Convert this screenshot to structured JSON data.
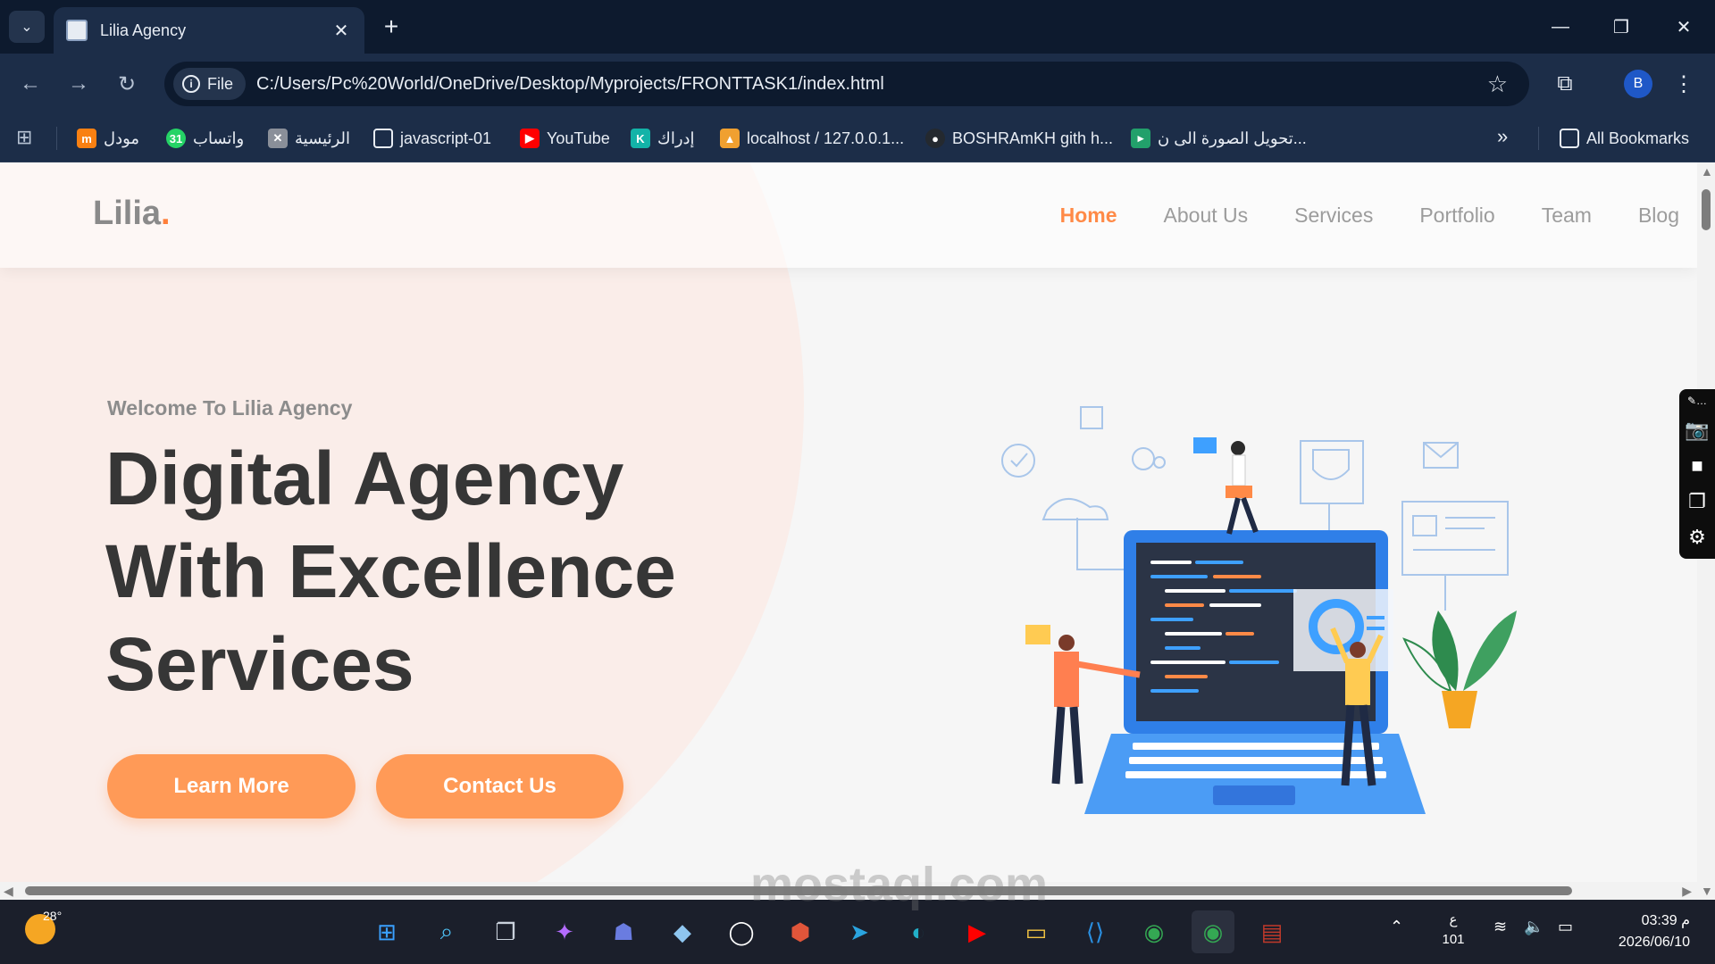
{
  "browser": {
    "tab_title": "Lilia Agency",
    "close_glyph": "✕",
    "new_tab_glyph": "+",
    "url_chip_label": "File",
    "url": "C:/Users/Pc%20World/OneDrive/Desktop/Myprojects/FRONTTASK1/index.html",
    "profile_initial": "B",
    "bookmarks": [
      {
        "label": "مودل",
        "icon": "moodle-icon",
        "color": "#f98012"
      },
      {
        "label": "واتساب",
        "icon": "whatsapp-icon",
        "color": "#25d366"
      },
      {
        "label": "الرئيسية",
        "icon": "x-icon",
        "color": "#8a8f99"
      },
      {
        "label": "javascript-01",
        "icon": "folder-icon",
        "color": "#1c2d48"
      },
      {
        "label": "YouTube",
        "icon": "youtube-icon",
        "color": "#ff0000"
      },
      {
        "label": "إدراك",
        "icon": "edraak-icon",
        "color": "#13b3a8"
      },
      {
        "label": "localhost / 127.0.0.1...",
        "icon": "phpmyadmin-icon",
        "color": "#f0a030"
      },
      {
        "label": "BOSHRAmKH gith h...",
        "icon": "github-icon",
        "color": "#24292f"
      },
      {
        "label": "تحويل الصورة الى ن...",
        "icon": "converter-icon",
        "color": "#22a06b"
      }
    ],
    "all_bookmarks_label": "All Bookmarks"
  },
  "site": {
    "logo_text": "Lilia",
    "logo_dot": ".",
    "nav": [
      {
        "label": "Home",
        "active": true
      },
      {
        "label": "About Us",
        "active": false
      },
      {
        "label": "Services",
        "active": false
      },
      {
        "label": "Portfolio",
        "active": false
      },
      {
        "label": "Team",
        "active": false
      },
      {
        "label": "Blog",
        "active": false
      }
    ],
    "hero": {
      "welcome": "Welcome To Lilia Agency",
      "headline": [
        "Digital Agency",
        "With Excellence",
        "Services"
      ],
      "btn_learn": "Learn More",
      "btn_contact": "Contact Us"
    },
    "accent_color": "#ff9a57"
  },
  "taskbar": {
    "weather_temp": "28°",
    "lang_line1": "ع",
    "lang_line2": "101",
    "time": "03:39 م",
    "date": "2026/06/10"
  },
  "watermark": "mostaql.com"
}
